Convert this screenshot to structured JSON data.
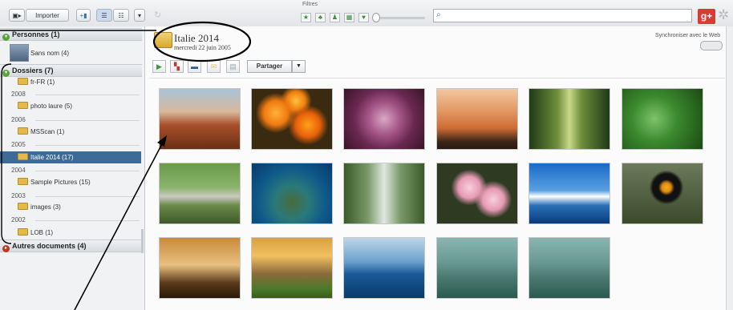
{
  "toolbar": {
    "import_label": "Importer",
    "filters_label": "Filtres",
    "filter_icons": [
      "★",
      "♣",
      "♟",
      "▦",
      "♥"
    ],
    "search_placeholder": "",
    "gplus_label": "g+"
  },
  "sidebar": {
    "people_header": "Personnes (1)",
    "person_name": "Sans nom (4)",
    "folders_header": "Dossiers (7)",
    "folders": [
      {
        "label": "fr-FR (1)"
      },
      {
        "year": "2008"
      },
      {
        "label": "photo laure (5)"
      },
      {
        "year": "2006"
      },
      {
        "label": "MSScan (1)"
      },
      {
        "year": "2005"
      },
      {
        "label": "Italie 2014 (17)"
      },
      {
        "year": "2004"
      },
      {
        "label": "Sample Pictures (15)"
      },
      {
        "year": "2003"
      },
      {
        "label": "images (3)"
      },
      {
        "year": "2002"
      },
      {
        "label": "LOB (1)"
      }
    ],
    "other_header": "Autres documents (4)"
  },
  "album": {
    "title": "Italie 2014",
    "date": "mercredi 22 juin 2005",
    "sync_label": "Synchroniser avec le Web",
    "share_label": "Partager"
  },
  "colors": {
    "selection": "#3d6b96",
    "folder": "#e4b94a",
    "gplus": "#d73d32",
    "annotation": "#000000"
  },
  "thumbnails": [
    {
      "name": "monument-valley"
    },
    {
      "name": "orange-flowers"
    },
    {
      "name": "succulent"
    },
    {
      "name": "desert-oryx"
    },
    {
      "name": "forest-path"
    },
    {
      "name": "green-leaves"
    },
    {
      "name": "stream-meadow"
    },
    {
      "name": "sea-turtle"
    },
    {
      "name": "waterfall"
    },
    {
      "name": "pink-flowers"
    },
    {
      "name": "pier-sunset"
    },
    {
      "name": "toucan"
    },
    {
      "name": "autumn-trees"
    },
    {
      "name": "autumn-lake"
    },
    {
      "name": "whale-tail"
    },
    {
      "name": "stilt-fishermen-1"
    },
    {
      "name": "stilt-fishermen-2"
    }
  ]
}
